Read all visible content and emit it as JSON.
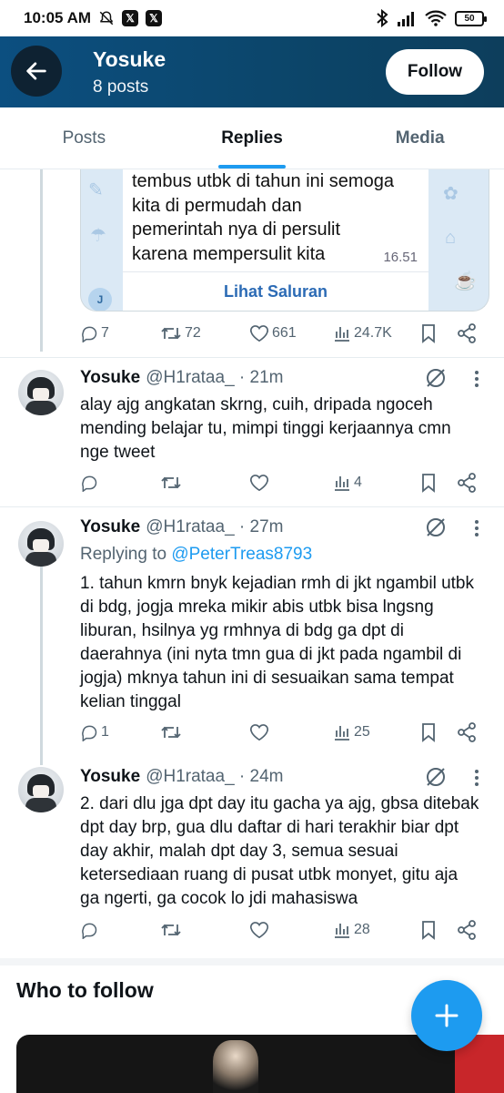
{
  "status_bar": {
    "time": "10:05 AM",
    "app_icons": [
      "silent-icon",
      "x-app-icon",
      "x-app-icon"
    ],
    "battery": "50"
  },
  "header": {
    "name": "Yosuke",
    "posts_count": "8 posts",
    "follow_label": "Follow"
  },
  "tabs": [
    {
      "label": "Posts",
      "active": false
    },
    {
      "label": "Replies",
      "active": true
    },
    {
      "label": "Media",
      "active": false
    }
  ],
  "media_card": {
    "lines": [
      "tembus utbk di tahun ini semoga",
      "kita di permudah dan",
      "pemerintah nya di persulit",
      "karena mempersulit kita"
    ],
    "time": "16.51",
    "channel_link": "Lihat Saluran",
    "badge": "J"
  },
  "quoted_actions": {
    "replies": "7",
    "reposts": "72",
    "likes": "661",
    "views": "24.7K"
  },
  "tweets": [
    {
      "name": "Yosuke",
      "handle": "@H1rataa_ · 21m",
      "replying_label": "",
      "replying_to": "",
      "lines": [
        "alay ajg angkatan skrng, cuih, dripada ngoceh",
        "mending belajar tu, mimpi tinggi kerjaannya cmn",
        "nge tweet"
      ],
      "replies": "",
      "reposts": "",
      "likes": "",
      "views": "4"
    },
    {
      "name": "Yosuke",
      "handle": "@H1rataa_ · 27m",
      "replying_label": "Replying to",
      "replying_to": "@PeterTreas8793",
      "lines": [
        "1. tahun kmrn bnyk kejadian rmh di jkt ngambil utbk",
        "di bdg, jogja mreka mikir abis utbk bisa lngsng",
        "liburan, hsilnya yg rmhnya di bdg ga dpt di",
        "daerahnya (ini nyta tmn gua di jkt pada ngambil di",
        "jogja) mknya tahun ini di sesuaikan sama tempat",
        "kelian tinggal"
      ],
      "replies": "1",
      "reposts": "",
      "likes": "",
      "views": "25"
    },
    {
      "name": "Yosuke",
      "handle": "@H1rataa_ · 24m",
      "replying_label": "",
      "replying_to": "",
      "lines": [
        "2. dari dlu jga dpt day itu gacha ya ajg, gbsa ditebak",
        "dpt day brp, gua dlu daftar di hari terakhir biar dpt",
        "day akhir, malah dpt day 3, semua sesuai",
        "ketersediaan ruang di pusat utbk monyet, gitu aja",
        "ga ngerti, ga cocok lo jdi mahasiswa"
      ],
      "replies": "",
      "reposts": "",
      "likes": "",
      "views": "28"
    }
  ],
  "who_to_follow": {
    "title": "Who to follow"
  },
  "colors": {
    "accent": "#1d9bf0",
    "header_bg": "#0c4f80",
    "text_secondary": "#536471"
  }
}
